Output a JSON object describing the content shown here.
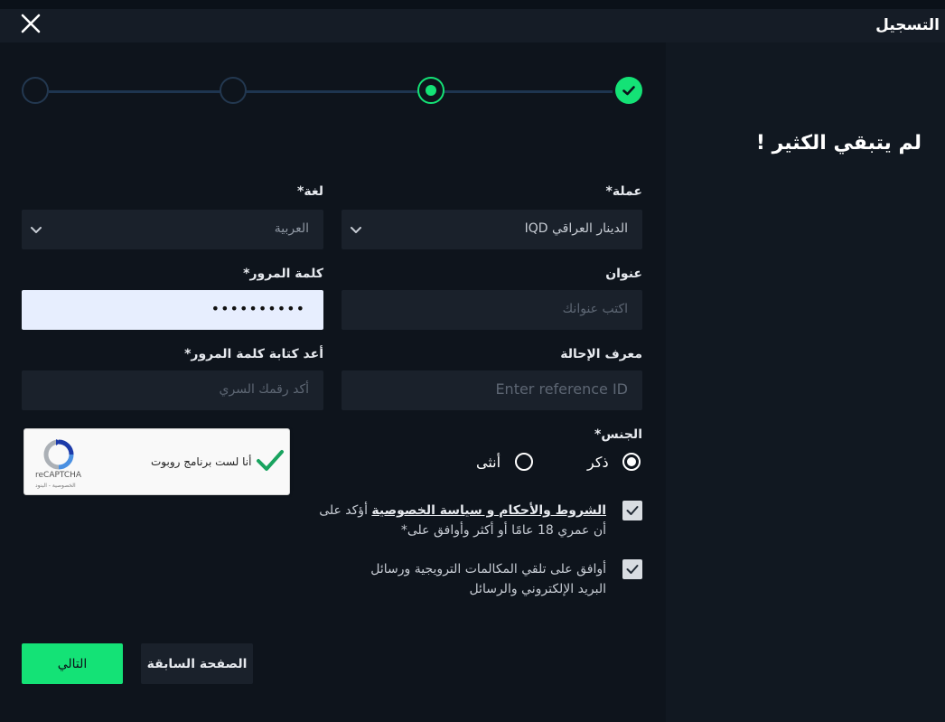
{
  "header": {
    "title": "التسجيل"
  },
  "form": {
    "heading": "لم يتبقي الكثير !",
    "currency": {
      "label": "عملة*",
      "value": "الدينار العراقي IQD"
    },
    "language": {
      "label": "لغة*",
      "value": "العربية"
    },
    "address": {
      "label": "عنوان",
      "placeholder": "اكتب عنوانك"
    },
    "password": {
      "label": "كلمة المرور*",
      "value": "••••••••••"
    },
    "referral": {
      "label": "معرف الإحالة",
      "placeholder": "Enter reference ID"
    },
    "confirm_password": {
      "label": "أعد كتابة كلمة المرور*",
      "placeholder": "أكد رقمك السري"
    },
    "gender": {
      "label": "الجنس*",
      "male": "ذكر",
      "female": "أنثى",
      "selected": "male"
    },
    "terms": {
      "link_text": "الشروط والأحكام و سياسة الخصوصية",
      "text_part": " أؤكد على",
      "line2": "أن عمري 18 عامًا أو أكثر وأوافق على*"
    },
    "promo": {
      "line1": "أوافق على تلقي المكالمات الترويجية ورسائل",
      "line2": "البريد الإلكتروني والرسائل"
    }
  },
  "captcha": {
    "text": "أنا لست برنامج روبوت",
    "brand": "reCAPTCHA",
    "legal": "الخصوصية - البنود"
  },
  "buttons": {
    "next": "التالي",
    "prev": "الصفحة السابقة"
  },
  "colors": {
    "accent": "#14e276",
    "field_bg": "#1a212b",
    "panel_bg": "#0e141c"
  },
  "icons": {
    "close": "close-icon",
    "chevron": "chevron-down-icon",
    "check": "check-icon"
  }
}
